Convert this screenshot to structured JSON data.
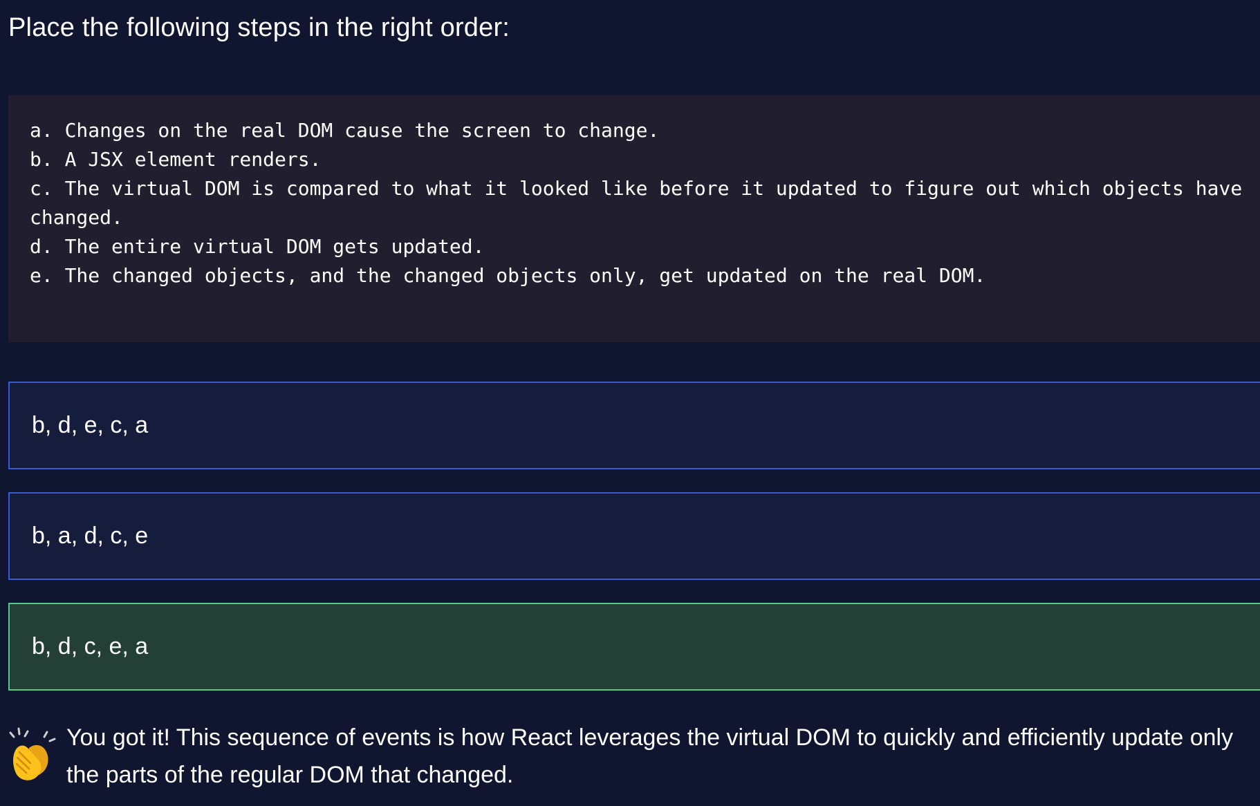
{
  "question": {
    "title": "Place the following steps in the right order:"
  },
  "code_block": {
    "lines": [
      "a. Changes on the real DOM cause the screen to change.",
      "b. A JSX element renders.",
      "c. The virtual DOM is compared to what it looked like before it updated to figure out which objects have",
      "changed.",
      "d. The entire virtual DOM gets updated.",
      "e. The changed objects, and the changed objects only, get updated on the real DOM."
    ]
  },
  "options": [
    {
      "label": "b, d, e, c, a",
      "state": "default"
    },
    {
      "label": "b, a, d, c, e",
      "state": "default"
    },
    {
      "label": "b, d, c, e, a",
      "state": "correct"
    }
  ],
  "feedback": {
    "icon": "clapping-hands-icon",
    "text": "You got it! This sequence of events is how React leverages the virtual DOM to quickly and efficiently update only the parts of the regular DOM that changed."
  },
  "colors": {
    "background": "#10162f",
    "code_background": "#211e2f",
    "option_border": "#3a59d6",
    "option_background": "#161c3c",
    "correct_border": "#55c98a",
    "correct_background": "#233f36"
  }
}
